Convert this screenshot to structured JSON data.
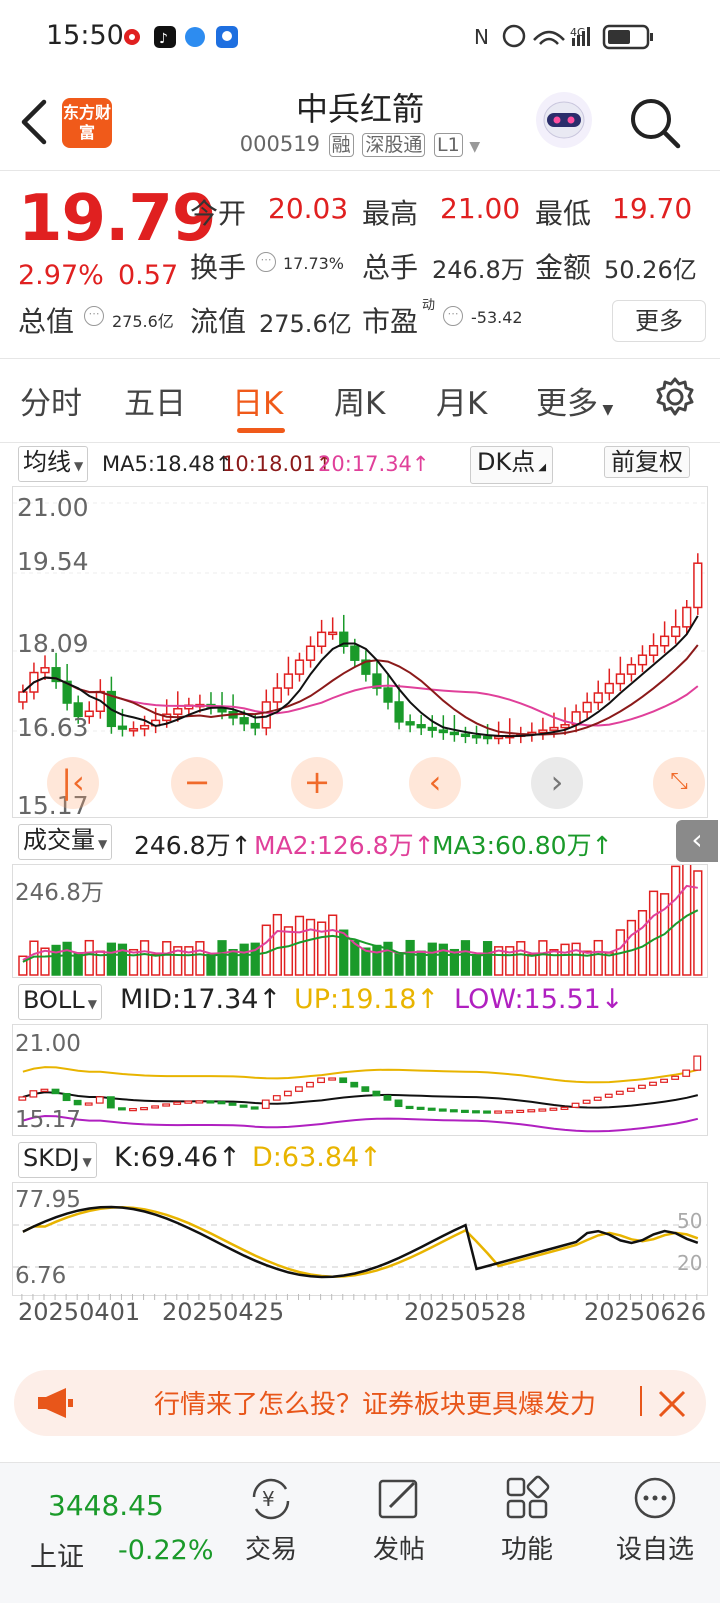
{
  "status_bar": {
    "time": "15:50",
    "network": "4G"
  },
  "header": {
    "logo_text": "东方财富",
    "stock_name": "中兵红箭",
    "stock_code": "000519",
    "tags": [
      "融",
      "深股通",
      "L1"
    ]
  },
  "quote": {
    "price": "19.79",
    "change_pct": "2.97%",
    "change": "0.57",
    "open_label": "今开",
    "open": "20.03",
    "high_label": "最高",
    "high": "21.00",
    "low_label": "最低",
    "low": "19.70",
    "turnover_label": "换手",
    "turnover": "17.73%",
    "volume_label": "总手",
    "volume": "246.8万",
    "amount_label": "金额",
    "amount": "50.26亿",
    "mcap_label": "总值",
    "mcap": "275.6亿",
    "float_label": "流值",
    "float_cap": "275.6亿",
    "pe_label": "市盈",
    "pe_sup": "动",
    "pe": "-53.42",
    "more_button": "更多"
  },
  "tabs": [
    "分时",
    "五日",
    "日K",
    "周K",
    "月K",
    "更多"
  ],
  "active_tab": "日K",
  "ma_bar": {
    "dropdown": "均线",
    "ma5": "MA5:18.48↑",
    "ma10": "10:18.01↑",
    "ma20": "20:17.34↑",
    "dk_button": "DK点",
    "adjust_button": "前复权"
  },
  "kline_axis": {
    "top": "21.00",
    "mid1": "19.54",
    "mid2": "18.09",
    "mid3": "16.63",
    "bottom": "15.17"
  },
  "vol_bar": {
    "dropdown": "成交量",
    "vol": "246.8万↑",
    "ma2": "MA2:126.8万↑",
    "ma3": "MA3:60.80万↑",
    "axis_top": "246.8万"
  },
  "boll_bar": {
    "dropdown": "BOLL",
    "mid": "MID:17.34↑",
    "up": "UP:19.18↑",
    "low": "LOW:15.51↓",
    "axis_top": "21.00",
    "axis_bottom": "15.17"
  },
  "skdj_bar": {
    "dropdown": "SKDJ",
    "k": "K:69.46↑",
    "d": "D:63.84↑",
    "axis_top": "77.95",
    "axis_bottom": "6.76",
    "ref_50": "50",
    "ref_20": "20"
  },
  "dates": [
    "20250401",
    "20250425",
    "20250528",
    "20250626"
  ],
  "banner": {
    "text": "行情来了怎么投？证券板块更具爆发力"
  },
  "bottom_nav": {
    "index_value": "3448.45",
    "index_name": "上证",
    "index_change": "-0.22%",
    "items": [
      "交易",
      "发帖",
      "功能",
      "设自选"
    ]
  },
  "colors": {
    "up": "#e02020",
    "down": "#1a9a2a",
    "accent": "#f05a1a",
    "ma10": "#8b1a1a",
    "ma20": "#e0409a",
    "ma_yellow": "#e8b400"
  },
  "chart_data": [
    {
      "type": "candlestick",
      "title": "日K",
      "ylim": [
        15.17,
        21.0
      ],
      "ma": {
        "MA5": 18.48,
        "MA10": 18.01,
        "MA20": 17.34
      },
      "x_ticks": [
        "20250401",
        "20250425",
        "20250528",
        "20250626"
      ]
    },
    {
      "type": "bar",
      "title": "成交量",
      "latest": "246.8万",
      "ma": {
        "MA2": "126.8万",
        "MA3": "60.80万"
      }
    },
    {
      "type": "line",
      "title": "BOLL",
      "series": [
        {
          "name": "MID",
          "latest": 17.34
        },
        {
          "name": "UP",
          "latest": 19.18
        },
        {
          "name": "LOW",
          "latest": 15.51
        }
      ],
      "ylim": [
        15.17,
        21.0
      ]
    },
    {
      "type": "line",
      "title": "SKDJ",
      "series": [
        {
          "name": "K",
          "latest": 69.46
        },
        {
          "name": "D",
          "latest": 63.84
        }
      ],
      "ylim": [
        6.76,
        77.95
      ]
    }
  ]
}
